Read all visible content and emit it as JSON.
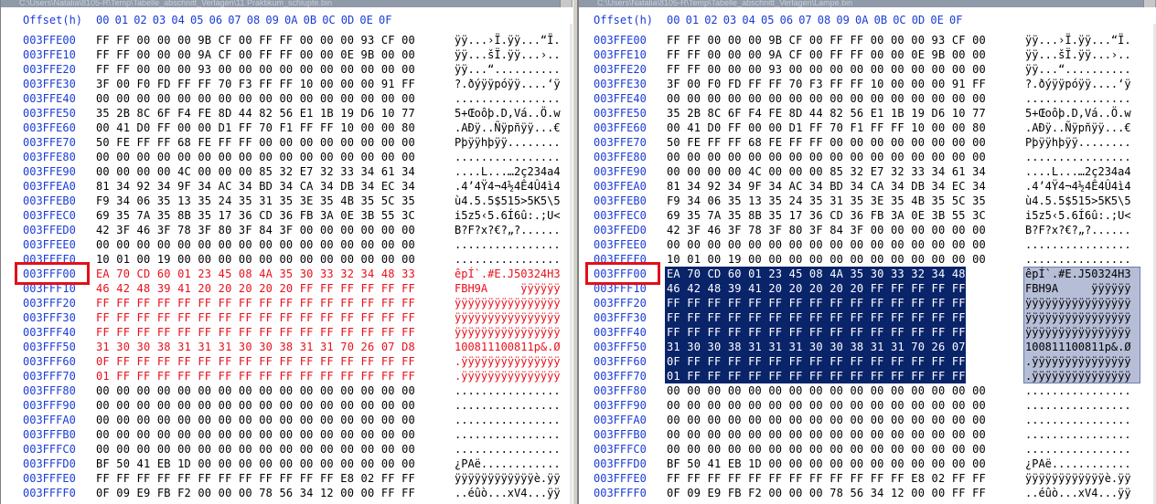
{
  "left": {
    "title": "C:\\Users\\Natalia\\8105-R\\Temp\\Tabelle_abschnitt_Verlagen\\11 Praktikum_schlupte.bin",
    "header": {
      "offset_label": "Offset(h)",
      "columns": [
        "00",
        "01",
        "02",
        "03",
        "04",
        "05",
        "06",
        "07",
        "08",
        "09",
        "0A",
        "0B",
        "0C",
        "0D",
        "0E",
        "0F"
      ]
    },
    "rows": [
      {
        "offset": "003FFE00",
        "hex": "FF FF 00 00 00 9B CF 00 FF FF 00 00 00 93 CF 00",
        "ascii": "ÿÿ...›Ï.ÿÿ...“Ï."
      },
      {
        "offset": "003FFE10",
        "hex": "FF FF 00 00 00 9A CF 00 FF FF 00 00 0E 9B 00 00",
        "ascii": "ÿÿ...šÏ.ÿÿ...›.."
      },
      {
        "offset": "003FFE20",
        "hex": "FF FF 00 00 00 93 00 00 00 00 00 00 00 00 00 00",
        "ascii": "ÿÿ...“.........."
      },
      {
        "offset": "003FFE30",
        "hex": "3F 00 F0 FD FF FF 70 F3 FF FF 10 00 00 00 91 FF",
        "ascii": "?.ðýÿÿpóÿÿ....‘ÿ"
      },
      {
        "offset": "003FFE40",
        "hex": "00 00 00 00 00 00 00 00 00 00 00 00 00 00 00 00",
        "ascii": "................"
      },
      {
        "offset": "003FFE50",
        "hex": "35 2B 8C 6F F4 FE 8D 44 82 56 E1 1B 19 D6 10 77",
        "ascii": "5+Œoôþ.D‚Vá..Ö.w"
      },
      {
        "offset": "003FFE60",
        "hex": "00 41 D0 FF 00 00 D1 FF 70 F1 FF FF 10 00 00 80",
        "ascii": ".AÐÿ..Ñÿpñÿÿ...€"
      },
      {
        "offset": "003FFE70",
        "hex": "50 FE FF FF 68 FE FF FF 00 00 00 00 00 00 00 00",
        "ascii": "Pþÿÿhþÿÿ........"
      },
      {
        "offset": "003FFE80",
        "hex": "00 00 00 00 00 00 00 00 00 00 00 00 00 00 00 00",
        "ascii": "................"
      },
      {
        "offset": "003FFE90",
        "hex": "00 00 00 00 4C 00 00 00 85 32 E7 32 33 34 61 34",
        "ascii": "....L...…2ç234a4"
      },
      {
        "offset": "003FFEA0",
        "hex": "81 34 92 34 9F 34 AC 34 BD 34 CA 34 DB 34 EC 34",
        "ascii": ".4’4Ÿ4¬4½4Ê4Û4ì4"
      },
      {
        "offset": "003FFEB0",
        "hex": "F9 34 06 35 13 35 24 35 31 35 3E 35 4B 35 5C 35",
        "ascii": "ù4.5.5$515>5K5\\5"
      },
      {
        "offset": "003FFEC0",
        "hex": "69 35 7A 35 8B 35 17 36 CD 36 FB 3A 0E 3B 55 3C",
        "ascii": "i5z5‹5.6Í6û:.;U<"
      },
      {
        "offset": "003FFED0",
        "hex": "42 3F 46 3F 78 3F 80 3F 84 3F 00 00 00 00 00 00",
        "ascii": "B?F?x?€?„?......"
      },
      {
        "offset": "003FFEE0",
        "hex": "00 00 00 00 00 00 00 00 00 00 00 00 00 00 00 00",
        "ascii": "................"
      },
      {
        "offset": "003FFEF0",
        "hex": "10 01 00 19 00 00 00 00 00 00 00 00 00 00 00 00",
        "ascii": "................"
      },
      {
        "offset": "003FFF00",
        "hex": "EA 70 CD 60 01 23 45 08 4A 35 30 33 32 34 48 33",
        "ascii": "êpÍ`.#E.J50324H3"
      },
      {
        "offset": "003FFF10",
        "hex": "46 42 48 39 41 20 20 20 20 20 FF FF FF FF FF FF",
        "ascii": "FBH9A     ÿÿÿÿÿÿ"
      },
      {
        "offset": "003FFF20",
        "hex": "FF FF FF FF FF FF FF FF FF FF FF FF FF FF FF FF",
        "ascii": "ÿÿÿÿÿÿÿÿÿÿÿÿÿÿÿÿ"
      },
      {
        "offset": "003FFF30",
        "hex": "FF FF FF FF FF FF FF FF FF FF FF FF FF FF FF FF",
        "ascii": "ÿÿÿÿÿÿÿÿÿÿÿÿÿÿÿÿ"
      },
      {
        "offset": "003FFF40",
        "hex": "FF FF FF FF FF FF FF FF FF FF FF FF FF FF FF FF",
        "ascii": "ÿÿÿÿÿÿÿÿÿÿÿÿÿÿÿÿ"
      },
      {
        "offset": "003FFF50",
        "hex": "31 30 30 38 31 31 31 30 30 38 31 31 70 26 07 D8",
        "ascii": "100811100811p&.Ø"
      },
      {
        "offset": "003FFF60",
        "hex": "0F FF FF FF FF FF FF FF FF FF FF FF FF FF FF FF",
        "ascii": ".ÿÿÿÿÿÿÿÿÿÿÿÿÿÿÿ"
      },
      {
        "offset": "003FFF70",
        "hex": "01 FF FF FF FF FF FF FF FF FF FF FF FF FF FF FF",
        "ascii": ".ÿÿÿÿÿÿÿÿÿÿÿÿÿÿÿ"
      },
      {
        "offset": "003FFF80",
        "hex": "00 00 00 00 00 00 00 00 00 00 00 00 00 00 00 00",
        "ascii": "................"
      },
      {
        "offset": "003FFF90",
        "hex": "00 00 00 00 00 00 00 00 00 00 00 00 00 00 00 00",
        "ascii": "................"
      },
      {
        "offset": "003FFFA0",
        "hex": "00 00 00 00 00 00 00 00 00 00 00 00 00 00 00 00",
        "ascii": "................"
      },
      {
        "offset": "003FFFB0",
        "hex": "00 00 00 00 00 00 00 00 00 00 00 00 00 00 00 00",
        "ascii": "................"
      },
      {
        "offset": "003FFFC0",
        "hex": "00 00 00 00 00 00 00 00 00 00 00 00 00 00 00 00",
        "ascii": "................"
      },
      {
        "offset": "003FFFD0",
        "hex": "BF 50 41 EB 1D 00 00 00 00 00 00 00 00 00 00 00",
        "ascii": "¿PAë............"
      },
      {
        "offset": "003FFFE0",
        "hex": "FF FF FF FF FF FF FF FF FF FF FF FF E8 02 FF FF",
        "ascii": "ÿÿÿÿÿÿÿÿÿÿÿÿè.ÿÿ"
      },
      {
        "offset": "003FFFF0",
        "hex": "0F 09 E9 FB F2 00 00 00 78 56 34 12 00 00 FF FF",
        "ascii": "..éûò...xV4...ÿÿ"
      }
    ]
  },
  "right": {
    "title": "C:\\Users\\Natalia\\8105-R\\Temp\\Tabelle_abschnitt_Verlagen\\Lampe.bin",
    "header": {
      "offset_label": "Offset(h)",
      "columns": [
        "00",
        "01",
        "02",
        "03",
        "04",
        "05",
        "06",
        "07",
        "08",
        "09",
        "0A",
        "0B",
        "0C",
        "0D",
        "0E",
        "0F"
      ]
    },
    "rows": [
      {
        "offset": "003FFE00",
        "hex": "FF FF 00 00 00 9B CF 00 FF FF 00 00 00 93 CF 00",
        "ascii": "ÿÿ...›Ï.ÿÿ...“Ï."
      },
      {
        "offset": "003FFE10",
        "hex": "FF FF 00 00 00 9A CF 00 FF FF 00 00 0E 9B 00 00",
        "ascii": "ÿÿ...šÏ.ÿÿ...›.."
      },
      {
        "offset": "003FFE20",
        "hex": "FF FF 00 00 00 93 00 00 00 00 00 00 00 00 00 00",
        "ascii": "ÿÿ...“.........."
      },
      {
        "offset": "003FFE30",
        "hex": "3F 00 F0 FD FF FF 70 F3 FF FF 10 00 00 00 91 FF",
        "ascii": "?.ðýÿÿpóÿÿ....‘ÿ"
      },
      {
        "offset": "003FFE40",
        "hex": "00 00 00 00 00 00 00 00 00 00 00 00 00 00 00 00",
        "ascii": "................"
      },
      {
        "offset": "003FFE50",
        "hex": "35 2B 8C 6F F4 FE 8D 44 82 56 E1 1B 19 D6 10 77",
        "ascii": "5+Œoôþ.D‚Vá..Ö.w"
      },
      {
        "offset": "003FFE60",
        "hex": "00 41 D0 FF 00 00 D1 FF 70 F1 FF FF 10 00 00 80",
        "ascii": ".AÐÿ..Ñÿpñÿÿ...€"
      },
      {
        "offset": "003FFE70",
        "hex": "50 FE FF FF 68 FE FF FF 00 00 00 00 00 00 00 00",
        "ascii": "Pþÿÿhþÿÿ........"
      },
      {
        "offset": "003FFE80",
        "hex": "00 00 00 00 00 00 00 00 00 00 00 00 00 00 00 00",
        "ascii": "................"
      },
      {
        "offset": "003FFE90",
        "hex": "00 00 00 00 4C 00 00 00 85 32 E7 32 33 34 61 34",
        "ascii": "....L...…2ç234a4"
      },
      {
        "offset": "003FFEA0",
        "hex": "81 34 92 34 9F 34 AC 34 BD 34 CA 34 DB 34 EC 34",
        "ascii": ".4’4Ÿ4¬4½4Ê4Û4ì4"
      },
      {
        "offset": "003FFEB0",
        "hex": "F9 34 06 35 13 35 24 35 31 35 3E 35 4B 35 5C 35",
        "ascii": "ù4.5.5$515>5K5\\5"
      },
      {
        "offset": "003FFEC0",
        "hex": "69 35 7A 35 8B 35 17 36 CD 36 FB 3A 0E 3B 55 3C",
        "ascii": "i5z5‹5.6Í6û:.;U<"
      },
      {
        "offset": "003FFED0",
        "hex": "42 3F 46 3F 78 3F 80 3F 84 3F 00 00 00 00 00 00",
        "ascii": "B?F?x?€?„?......"
      },
      {
        "offset": "003FFEE0",
        "hex": "00 00 00 00 00 00 00 00 00 00 00 00 00 00 00 00",
        "ascii": "................"
      },
      {
        "offset": "003FFEF0",
        "hex": "10 01 00 19 00 00 00 00 00 00 00 00 00 00 00 00",
        "ascii": "................"
      },
      {
        "offset": "003FFF00",
        "hex": "EA 70 CD 60 01 23 45 08 4A 35 30 33 32 34 48 33",
        "ascii": "êpÍ`.#E.J50324H3"
      },
      {
        "offset": "003FFF10",
        "hex": "46 42 48 39 41 20 20 20 20 20 FF FF FF FF FF FF",
        "ascii": "FBH9A     ÿÿÿÿÿÿ"
      },
      {
        "offset": "003FFF20",
        "hex": "FF FF FF FF FF FF FF FF FF FF FF FF FF FF FF FF",
        "ascii": "ÿÿÿÿÿÿÿÿÿÿÿÿÿÿÿÿ"
      },
      {
        "offset": "003FFF30",
        "hex": "FF FF FF FF FF FF FF FF FF FF FF FF FF FF FF FF",
        "ascii": "ÿÿÿÿÿÿÿÿÿÿÿÿÿÿÿÿ"
      },
      {
        "offset": "003FFF40",
        "hex": "FF FF FF FF FF FF FF FF FF FF FF FF FF FF FF FF",
        "ascii": "ÿÿÿÿÿÿÿÿÿÿÿÿÿÿÿÿ"
      },
      {
        "offset": "003FFF50",
        "hex": "31 30 30 38 31 31 31 30 30 38 31 31 70 26 07 D8",
        "ascii": "100811100811p&.Ø"
      },
      {
        "offset": "003FFF60",
        "hex": "0F FF FF FF FF FF FF FF FF FF FF FF FF FF FF FF",
        "ascii": ".ÿÿÿÿÿÿÿÿÿÿÿÿÿÿÿ"
      },
      {
        "offset": "003FFF70",
        "hex": "01 FF FF FF FF FF FF FF FF FF FF FF FF FF FF FF",
        "ascii": ".ÿÿÿÿÿÿÿÿÿÿÿÿÿÿÿ"
      },
      {
        "offset": "003FFF80",
        "hex": "00 00 00 00 00 00 00 00 00 00 00 00 00 00 00 00",
        "ascii": "................"
      },
      {
        "offset": "003FFF90",
        "hex": "00 00 00 00 00 00 00 00 00 00 00 00 00 00 00 00",
        "ascii": "................"
      },
      {
        "offset": "003FFFA0",
        "hex": "00 00 00 00 00 00 00 00 00 00 00 00 00 00 00 00",
        "ascii": "................"
      },
      {
        "offset": "003FFFB0",
        "hex": "00 00 00 00 00 00 00 00 00 00 00 00 00 00 00 00",
        "ascii": "................"
      },
      {
        "offset": "003FFFC0",
        "hex": "00 00 00 00 00 00 00 00 00 00 00 00 00 00 00 00",
        "ascii": "................"
      },
      {
        "offset": "003FFFD0",
        "hex": "BF 50 41 EB 1D 00 00 00 00 00 00 00 00 00 00 00",
        "ascii": "¿PAë............"
      },
      {
        "offset": "003FFFE0",
        "hex": "FF FF FF FF FF FF FF FF FF FF FF FF E8 02 FF FF",
        "ascii": "ÿÿÿÿÿÿÿÿÿÿÿÿè.ÿÿ"
      },
      {
        "offset": "003FFFF0",
        "hex": "0F 09 E9 FB F2 00 00 00 78 56 34 12 00 00 FF FF",
        "ascii": "..éûò...xV4...ÿÿ"
      }
    ]
  },
  "highlight": {
    "offset": "003FFF00",
    "first_row": 16,
    "last_row": 23,
    "left_style": "modified-red-text",
    "right_style": "selection"
  },
  "colors": {
    "offset_blue": "#1a3cd6",
    "modified_red": "#e8101a",
    "selection_navy": "#0a246a",
    "marker_red": "#e0101a"
  }
}
